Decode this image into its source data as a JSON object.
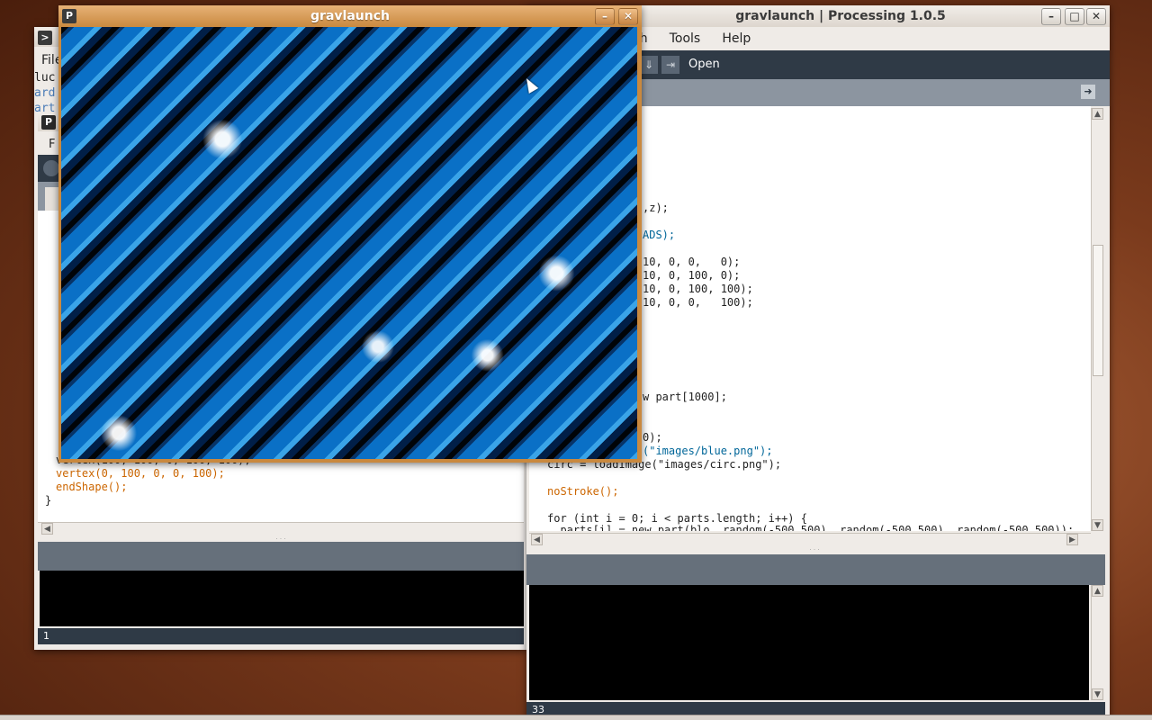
{
  "sketch_window": {
    "title": "gravlaunch",
    "minimize": "–",
    "close": "✕"
  },
  "pde_right": {
    "title": "gravlaunch | Processing 1.0.5",
    "menus": [
      "ch",
      "Tools",
      "Help"
    ],
    "toolbar_label": "Open",
    "code": [
      ",z);",
      "ADS);",
      "10, 0, 0,   0);",
      "10, 0, 100, 0);",
      "10, 0, 100, 100);",
      "10, 0, 0,   100);",
      "w part[1000];",
      "0);",
      "(\"images/blue.png\");",
      "circ = loadImage(\"images/circ.png\");",
      "noStroke();",
      "for (int i = 0; i < parts.length; i++) {",
      "  parts[i] = new part(blo, random(-500,500), random(-500,500), random(-500,500));"
    ],
    "status_line": "33"
  },
  "pde_left": {
    "menu_file": "File",
    "menu_f": "F",
    "side_text": [
      "luc",
      "ard",
      "art"
    ],
    "code": [
      "vertex(100, 100, 0, 100, 100);",
      "vertex(0, 100, 0, 0, 100);",
      "endShape();",
      "}"
    ],
    "status_line": "1"
  },
  "colors": {
    "accent_title": "#c9893f",
    "pde_toolbar": "#2f3a46",
    "keyword": "#cc6600",
    "string": "#006699"
  }
}
